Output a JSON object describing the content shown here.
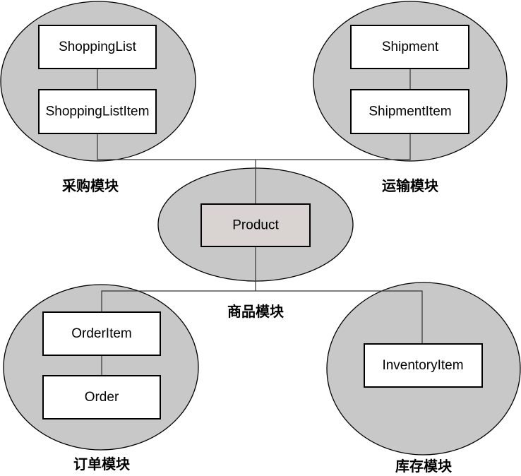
{
  "modules": {
    "purchasing": {
      "label": "采购模块",
      "entities": [
        "ShoppingList",
        "ShoppingListItem"
      ]
    },
    "shipping": {
      "label": "运输模块",
      "entities": [
        "Shipment",
        "ShipmentItem"
      ]
    },
    "product": {
      "label": "商品模块",
      "entities": [
        "Product"
      ]
    },
    "order": {
      "label": "订单模块",
      "entities": [
        "OrderItem",
        "Order"
      ]
    },
    "inventory": {
      "label": "库存模块",
      "entities": [
        "InventoryItem"
      ]
    }
  },
  "colors": {
    "module_fill": "#c8c8c8",
    "entity_fill": "#ffffff",
    "central_entity_fill": "#d9d4d2",
    "line": "#333333"
  }
}
